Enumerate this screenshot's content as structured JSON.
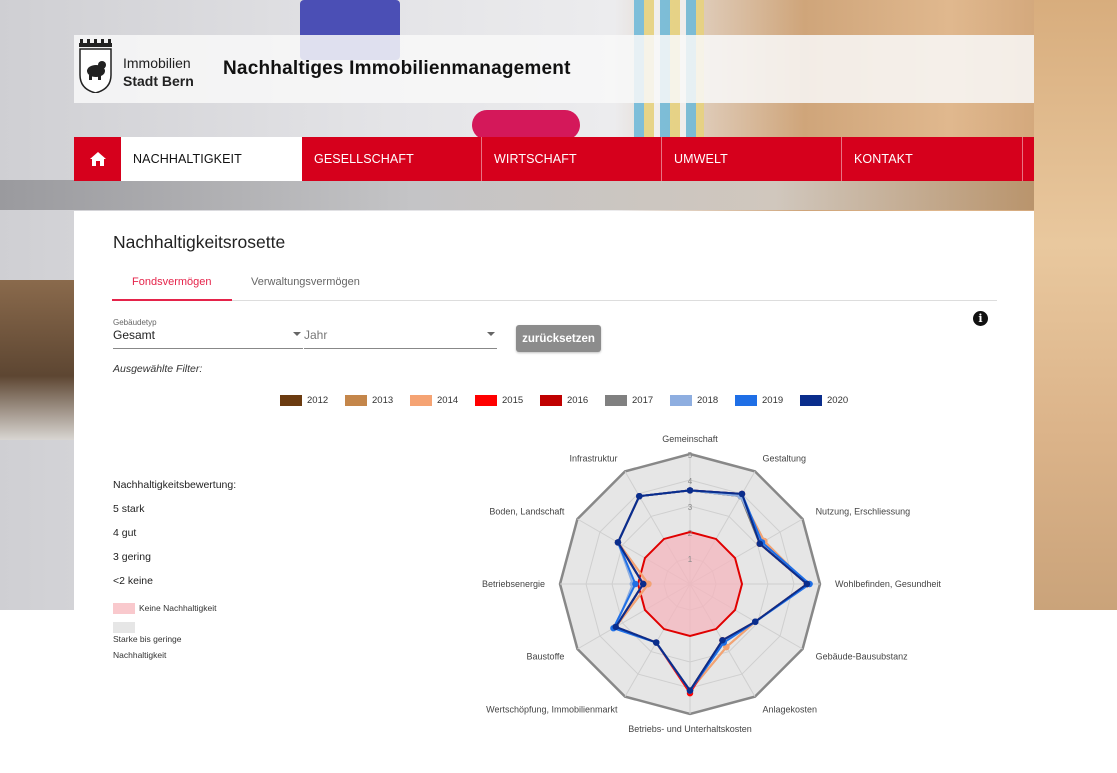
{
  "header": {
    "logo_line1": "Immobilien",
    "logo_line2": "Stadt Bern",
    "title": "Nachhaltiges Immobilienmanagement"
  },
  "nav": {
    "items": [
      {
        "label": "NACHHALTIGKEIT",
        "active": true
      },
      {
        "label": "GESELLSCHAFT",
        "active": false
      },
      {
        "label": "WIRTSCHAFT",
        "active": false
      },
      {
        "label": "UMWELT",
        "active": false
      },
      {
        "label": "KONTAKT",
        "active": false
      }
    ]
  },
  "page": {
    "title": "Nachhaltigkeitsrosette",
    "tabs": [
      "Fondsvermögen",
      "Verwaltungsvermögen"
    ],
    "active_tab": "Fondsvermögen"
  },
  "filters": {
    "gebaeudetyp_label": "Gebäudetyp",
    "gebaeudetyp_value": "Gesamt",
    "jahr_placeholder": "Jahr",
    "reset_label": "zurücksetzen",
    "selected_label": "Ausgewählte Filter:"
  },
  "rating": {
    "title": "Nachhaltigkeitsbewertung:",
    "levels": [
      "5 stark",
      "4 gut",
      "3 gering",
      "<2 keine"
    ],
    "key_none": "Keine Nachhaltigkeit",
    "key_some_line1": "Starke bis geringe",
    "key_some_line2": "Nachhaltigkeit"
  },
  "colors": {
    "brand_red": "#d6001c",
    "tab_active": "#e5234a",
    "keine_fill": "#f9c9cd",
    "starke_fill": "#e6e6e6"
  },
  "chart_data": {
    "type": "radar",
    "title": "",
    "axes": [
      "Gemeinschaft",
      "Gestaltung",
      "Nutzung, Erschliessung",
      "Wohlbefinden, Gesundheit",
      "Gebäude-Bausubstanz",
      "Anlagekosten",
      "Betriebs- und Unterhaltskosten",
      "Wertschöpfung, Immobilienmarkt",
      "Baustoffe",
      "Betriebsenergie",
      "Boden, Landschaft",
      "Infrastruktur"
    ],
    "scale_labels": [
      "1",
      "2",
      "3",
      "4",
      "5"
    ],
    "range": [
      0,
      5
    ],
    "threshold": 2,
    "series": [
      {
        "name": "2012",
        "color": "#6b3b10",
        "values": [
          3.6,
          3.9,
          3.1,
          4.5,
          2.9,
          2.5,
          4.1,
          2.6,
          3.3,
          1.8,
          3.2,
          3.9
        ]
      },
      {
        "name": "2013",
        "color": "#c4864a",
        "values": [
          3.6,
          3.9,
          3.3,
          4.5,
          2.9,
          2.8,
          4.1,
          2.6,
          3.3,
          1.6,
          3.2,
          3.9
        ]
      },
      {
        "name": "2014",
        "color": "#f5a373",
        "values": [
          3.6,
          3.9,
          3.3,
          4.5,
          2.9,
          2.8,
          4.1,
          2.6,
          3.3,
          1.6,
          3.2,
          3.9
        ]
      },
      {
        "name": "2015",
        "color": "#ff0000",
        "values": [
          3.6,
          4.0,
          3.1,
          4.5,
          2.9,
          2.5,
          4.2,
          2.6,
          3.3,
          1.8,
          3.2,
          3.9
        ]
      },
      {
        "name": "2016",
        "color": "#c00000",
        "values": [
          3.6,
          4.0,
          3.1,
          4.5,
          2.9,
          2.5,
          4.1,
          2.6,
          3.3,
          1.8,
          3.2,
          3.9
        ]
      },
      {
        "name": "2017",
        "color": "#808080",
        "values": [
          3.6,
          3.9,
          3.1,
          4.5,
          2.9,
          2.5,
          4.1,
          2.6,
          3.3,
          1.8,
          3.2,
          3.9
        ]
      },
      {
        "name": "2018",
        "color": "#8eaee0",
        "values": [
          3.6,
          3.9,
          3.2,
          4.6,
          2.9,
          2.6,
          4.1,
          2.6,
          3.3,
          2.2,
          3.2,
          3.9
        ]
      },
      {
        "name": "2019",
        "color": "#1f6fe6",
        "values": [
          3.6,
          4.0,
          3.2,
          4.6,
          2.9,
          2.6,
          4.1,
          2.6,
          3.4,
          2.1,
          3.2,
          3.9
        ]
      },
      {
        "name": "2020",
        "color": "#0a2d8c",
        "values": [
          3.6,
          4.0,
          3.1,
          4.5,
          2.9,
          2.5,
          4.1,
          2.6,
          3.3,
          1.8,
          3.2,
          3.9
        ]
      }
    ],
    "grid": true,
    "legend_position": "top"
  }
}
